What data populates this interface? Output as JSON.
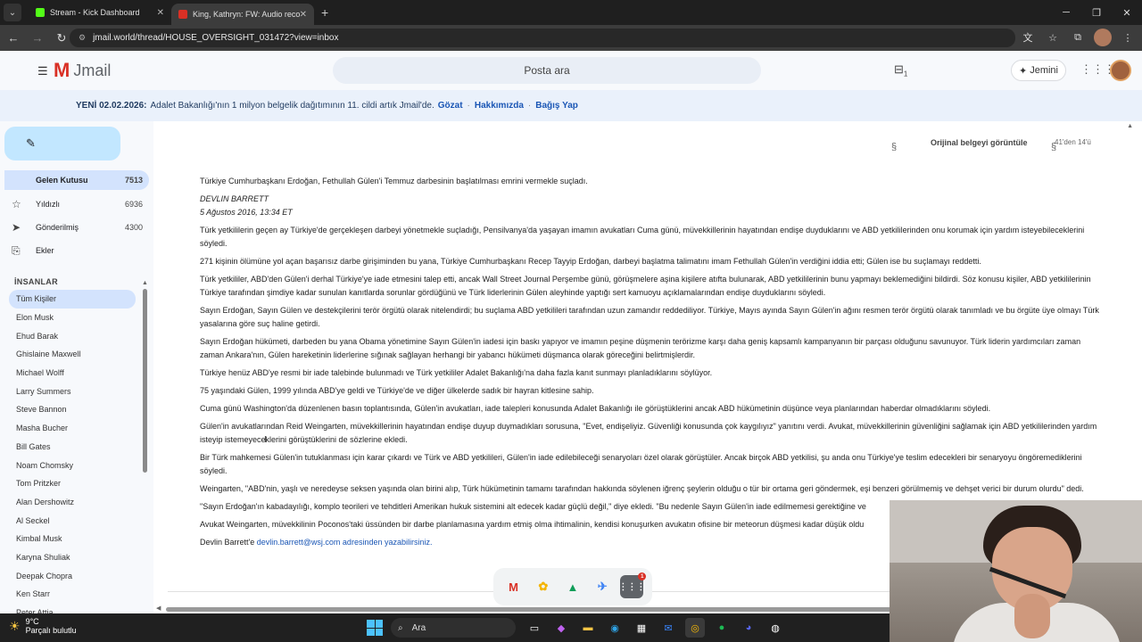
{
  "browser": {
    "tabs": [
      {
        "title": "Stream - Kick Dashboard",
        "favicon_color": "#53fc18"
      },
      {
        "title": "King, Kathryn: FW: Audio recor...",
        "favicon_color": "#d93025"
      }
    ],
    "url": "jmail.world/thread/HOUSE_OVERSIGHT_031472?view=inbox"
  },
  "header": {
    "logo_text": "Jmail",
    "search_placeholder": "Posta ara",
    "jemini_label": "Jemini",
    "notif_count": "1"
  },
  "banner": {
    "prefix": "YENİ 02.02.2026:",
    "text": "Adalet Bakanlığı'nın 1 milyon belgelik dağıtımının 11. cildi artık Jmail'de.",
    "link1": "Gözat",
    "link2": "Hakkımızda",
    "link3": "Bağış Yap"
  },
  "sidebar": {
    "folders": [
      {
        "label": "Gelen Kutusu",
        "count": "7513"
      },
      {
        "label": "Yıldızlı",
        "count": "6936"
      },
      {
        "label": "Gönderilmiş",
        "count": "4300"
      },
      {
        "label": "Ekler",
        "count": ""
      }
    ],
    "people_heading": "İNSANLAR",
    "people": [
      "Tüm Kişiler",
      "Elon Musk",
      "Ehud Barak",
      "Ghislaine Maxwell",
      "Michael Wolff",
      "Larry Summers",
      "Steve Bannon",
      "Masha Bucher",
      "Bill Gates",
      "Noam Chomsky",
      "Tom Pritzker",
      "Alan Dershowitz",
      "Al Seckel",
      "Kimbal Musk",
      "Karyna Shuliak",
      "Deepak Chopra",
      "Ken Starr",
      "Peter Attia"
    ]
  },
  "message": {
    "view_original": "Orijinal belgeyi görüntüle",
    "pager": "41'den 14'ü",
    "lead": "Türkiye Cumhurbaşkanı Erdoğan, Fethullah Gülen'i Temmuz darbesinin başlatılması emrini vermekle suçladı.",
    "byline": "DEVLIN BARRETT",
    "dateline": "5 Ağustos 2016, 13:34 ET",
    "paragraphs": [
      "Türk yetkililerin geçen ay Türkiye'de gerçekleşen darbeyi yönetmekle suçladığı, Pensilvanya'da yaşayan imamın avukatları Cuma günü, müvekkillerinin hayatından endişe duyduklarını ve ABD yetkililerinden onu korumak için yardım isteyebileceklerini söyledi.",
      "271 kişinin ölümüne yol açan başarısız darbe girişiminden bu yana, Türkiye Cumhurbaşkanı Recep Tayyip Erdoğan, darbeyi başlatma talimatını imam Fethullah Gülen'in verdiğini iddia etti; Gülen ise bu suçlamayı reddetti.",
      "Türk yetkililer, ABD'den Gülen'i derhal Türkiye'ye iade etmesini talep etti, ancak Wall Street Journal Perşembe günü, görüşmelere aşina kişilere atıfta bulunarak, ABD yetkililerinin bunu yapmayı beklemediğini bildirdi. Söz konusu kişiler, ABD yetkililerinin Türkiye tarafından şimdiye kadar sunulan kanıtlarda sorunlar gördüğünü ve Türk liderlerinin Gülen aleyhinde yaptığı sert kamuoyu açıklamalarından endişe duyduklarını söyledi.",
      "Sayın Erdoğan, Sayın Gülen ve destekçilerini terör örgütü olarak nitelendirdi; bu suçlama ABD yetkilileri tarafından uzun zamandır reddediliyor. Türkiye, Mayıs ayında Sayın Gülen'in ağını resmen terör örgütü olarak tanımladı ve bu örgüte üye olmayı Türk yasalarına göre suç haline getirdi.",
      "Sayın Erdoğan hükümeti, darbeden bu yana Obama yönetimine Sayın Gülen'in iadesi için baskı yapıyor ve imamın peşine düşmenin terörizme karşı daha geniş kapsamlı kampanyanın bir parçası olduğunu savunuyor. Türk liderin yardımcıları zaman zaman Ankara'nın, Gülen hareketinin liderlerine sığınak sağlayan herhangi bir yabancı hükümeti düşmanca olarak göreceğini belirtmişlerdir.",
      "Türkiye henüz ABD'ye resmi bir iade talebinde bulunmadı ve Türk yetkililer Adalet Bakanlığı'na daha fazla kanıt sunmayı planladıklarını söylüyor.",
      "75 yaşındaki Gülen, 1999 yılında ABD'ye geldi ve Türkiye'de ve diğer ülkelerde sadık bir hayran kitlesine sahip.",
      "Cuma günü Washington'da düzenlenen basın toplantısında, Gülen'in avukatları, iade talepleri konusunda Adalet Bakanlığı ile görüştüklerini ancak ABD hükümetinin düşünce veya planlarından haberdar olmadıklarını söyledi.",
      "Gülen'in avukatlarından Reid Weingarten, müvekkillerinin hayatından endişe duyup duymadıkları sorusuna, \"Evet, endişeliyiz. Güvenliği konusunda çok kaygılıyız\" yanıtını verdi. Avukat, müvekkillerinin güvenliğini sağlamak için ABD yetkililerinden yardım isteyip istemeyeceklerini görüştüklerini de sözlerine ekledi.",
      "Bir Türk mahkemesi Gülen'in tutuklanması için karar çıkardı ve Türk ve ABD yetkilileri, Gülen'in iade edilebileceği senaryoları özel olarak görüştüler. Ancak birçok ABD yetkilisi, şu anda onu Türkiye'ye teslim edecekleri bir senaryoyu öngöremediklerini söyledi.",
      "Weingarten, \"ABD'nin, yaşlı ve neredeyse seksen yaşında olan birini alıp, Türk hükümetinin tamamı tarafından hakkında söylenen iğrenç şeylerin olduğu o tür bir ortama geri göndermek, eşi benzeri görülmemiş ve dehşet verici bir durum olurdu\" dedi.",
      "\"Sayın Erdoğan'ın kabadayılığı, komplo teorileri ve tehditleri Amerikan hukuk sistemini alt edecek kadar güçlü değil,\" diye ekledi. \"Bu nedenle Sayın Gülen'in iade edilmemesi gerektiğine ve",
      "Avukat Weingarten, müvekkilinin Poconos'taki üssünden bir darbe planlamasına yardım etmiş olma ihtimalinin, kendisi konuşurken avukatın ofisine bir meteorun düşmesi kadar düşük oldu"
    ],
    "contact_prefix": "Devlin Barrett'e",
    "contact_link": "devlin.barrett@wsj.com adresinden yazabilirsiniz."
  },
  "dock": {
    "apps": [
      "gmail-icon",
      "photos-icon",
      "drive-icon",
      "flights-icon",
      "apps-grid-icon"
    ],
    "badge": "1"
  },
  "taskbar": {
    "temperature": "9°C",
    "weather": "Parçalı bulutlu",
    "search_label": "Ara"
  }
}
